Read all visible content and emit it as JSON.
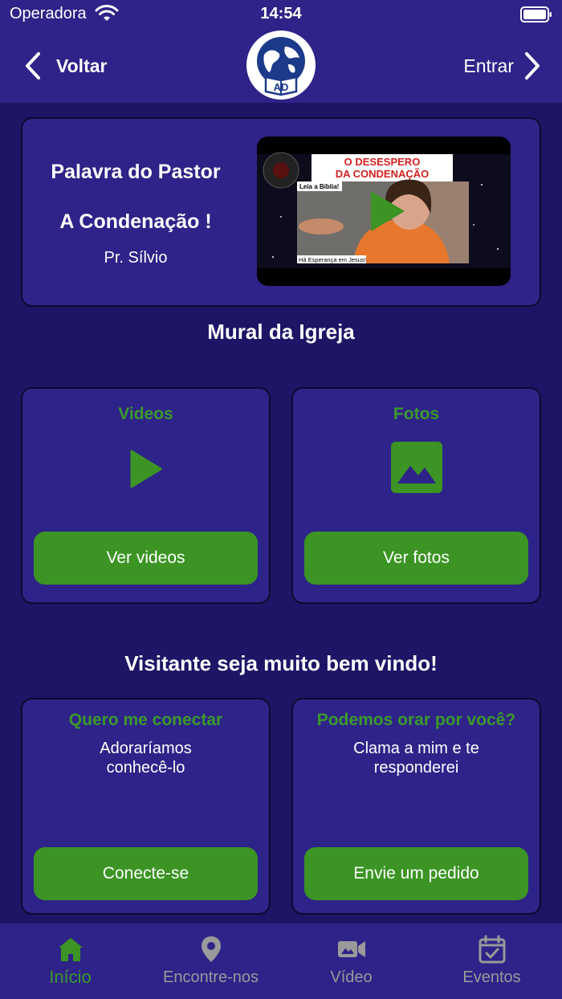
{
  "status_bar": {
    "carrier": "Operadora",
    "time": "14:54"
  },
  "nav": {
    "back_label": "Voltar",
    "login_label": "Entrar",
    "logo_text": "AD"
  },
  "pastor": {
    "title": "Palavra do Pastor",
    "sermon": "A Condenação !",
    "name": "Pr. Sílvio",
    "thumbnail": {
      "headline_line1": "O DESESPERO",
      "headline_line2": "DA CONDENAÇÃO",
      "caption_top": "Leia a Bíblia!",
      "caption_bottom": "Há Esperança em Jesus!"
    }
  },
  "mural": {
    "title": "Mural da Igreja",
    "videos": {
      "title": "Videos",
      "button": "Ver videos"
    },
    "photos": {
      "title": "Fotos",
      "button": "Ver fotos"
    }
  },
  "welcome": {
    "title": "Visitante seja muito bem vindo!",
    "connect": {
      "title": "Quero me conectar",
      "desc_line1": "Adoraríamos",
      "desc_line2": "conhecê-lo",
      "button": "Conecte-se"
    },
    "prayer": {
      "title": "Podemos orar por você?",
      "desc_line1": "Clama a mim e te",
      "desc_line2": "responderei",
      "button": "Envie um pedido"
    }
  },
  "tabs": [
    {
      "label": "Início",
      "icon": "home-icon",
      "active": true
    },
    {
      "label": "Encontre-nos",
      "icon": "map-pin-icon",
      "active": false
    },
    {
      "label": "Vídeo",
      "icon": "video-camera-icon",
      "active": false
    },
    {
      "label": "Eventos",
      "icon": "calendar-check-icon",
      "active": false
    }
  ],
  "colors": {
    "background": "#1e1566",
    "card": "#2e2388",
    "accent_green": "#3c9424",
    "accent_green_text": "#3c9a2c",
    "inactive_tab": "#9a9a9a"
  }
}
